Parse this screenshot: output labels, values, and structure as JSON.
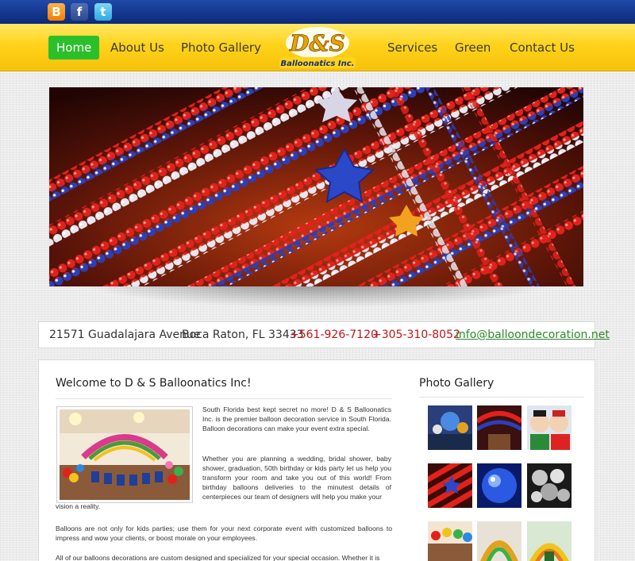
{
  "social": {
    "icons": [
      "blogger-icon",
      "facebook-icon",
      "twitter-icon"
    ],
    "blogger_glyph": "B",
    "facebook_glyph": "f",
    "twitter_glyph": "t"
  },
  "nav": {
    "home": "Home",
    "about": "About Us",
    "gallery": "Photo Gallery",
    "services": "Services",
    "green": "Green",
    "contact": "Contact Us"
  },
  "logo": {
    "mark": "D&S",
    "name": "Balloonatics Inc."
  },
  "address": {
    "street": "21571 Guadalajara Avenue",
    "city": "Boca Raton, FL 33433",
    "phone1": "+561-926-7120",
    "phone2": "+305-310-8052",
    "email": "info@balloondecoration.net"
  },
  "main": {
    "title": "Welcome to D & S Balloonatics Inc!",
    "p1": "South Florida best kept secret no more! D & S Balloonatics Inc. is the premier balloon decoration service in South Florida. Balloon decorations can make your event extra special.",
    "p2": "Whether you are planning a wedding, bridal shower, baby shower, graduation, 50th birthday or kids party let us help you transform your room and take you out of this world! From birthday balloons deliveries to the minutest details of centerpieces our team of designers will help you make your",
    "p2_tail": "vision a reality.",
    "p3": "Balloons are not only for kids parties; use them for your next corporate event with customized balloons to impress and wow your clients, or boost morale on your employees.",
    "p4": "All of our balloons decorations are custom designed and specialized for your special occasion. Whether it is"
  },
  "sidebar": {
    "title": "Photo Gallery"
  },
  "colors": {
    "nav_active": "#2bc02b",
    "nav_bg": "#ffd31a",
    "topbar": "#0b2a7a",
    "phone": "#c1141a",
    "email": "#2c8a2c"
  }
}
